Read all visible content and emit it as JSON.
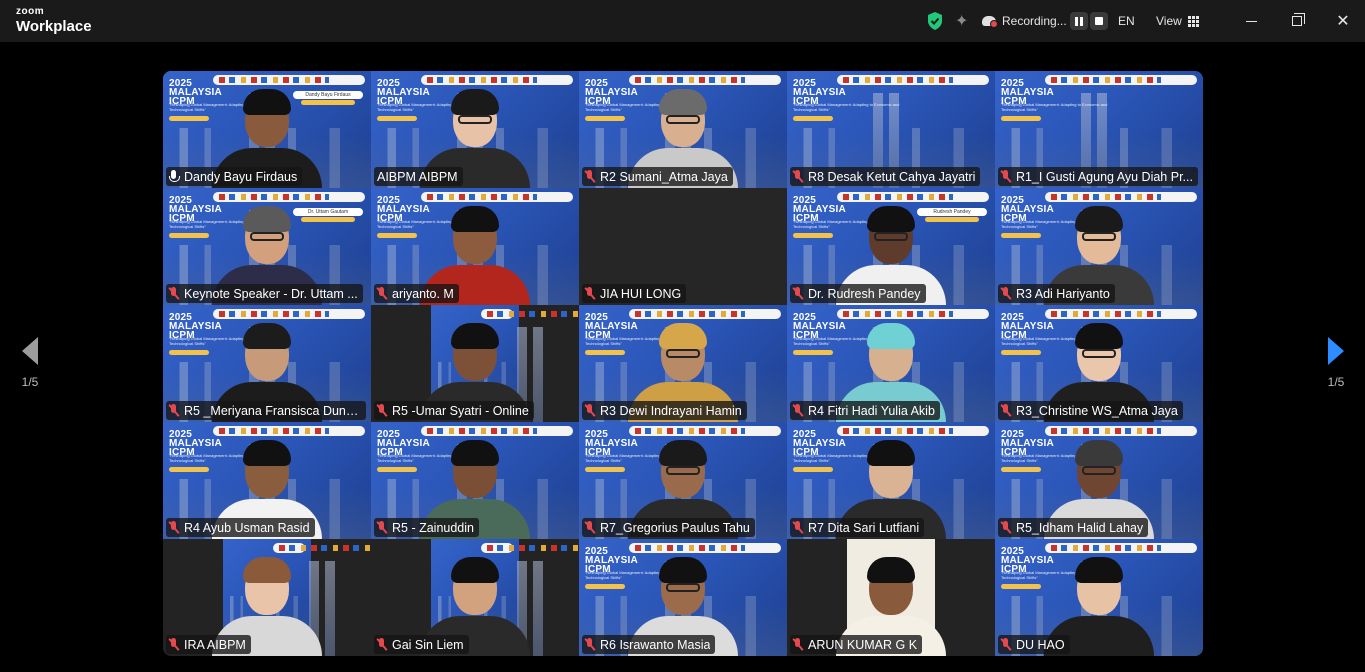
{
  "app": {
    "brand_top": "zoom",
    "brand_bottom": "Workplace"
  },
  "topbar": {
    "recording_label": "Recording...",
    "language": "EN",
    "view_label": "View",
    "close_glyph": "✕",
    "sparkle_glyph": "✦"
  },
  "pager": {
    "left_label": "1/5",
    "right_label": "1/5"
  },
  "colors": {
    "speaking_outline": "#21c87a",
    "muted_icon": "#e5484d",
    "accent": "#2d8cff",
    "slide_blue": "#2b56b8"
  },
  "slide": {
    "title_line1": "2025",
    "title_line2": "MALAYSIA",
    "title_line3": "ICPM",
    "subtitle": "\"Reshaping Global Management: Adapting to Economic and Technological Shifts\""
  },
  "participants": [
    {
      "name": "Dandy Bayu Firdaus",
      "mic": "on",
      "speaking": true,
      "bg": "slide",
      "skin": "#8a5a3c",
      "hair": "#111",
      "shirt": "#1c1c1c",
      "glasses": false,
      "card": "Dandy Bayu Firdaus"
    },
    {
      "name": "AIBPM AIBPM",
      "mic": "none",
      "speaking": false,
      "bg": "slide",
      "skin": "#e8c2a6",
      "hair": "#1a1a1a",
      "shirt": "#2a2a2a",
      "glasses": true,
      "card": ""
    },
    {
      "name": "R2 Sumani_Atma Jaya",
      "mic": "off",
      "speaking": false,
      "bg": "slide",
      "skin": "#d9b08f",
      "hair": "#6b6b6b",
      "shirt": "#c9c9c9",
      "glasses": true,
      "card": ""
    },
    {
      "name": "R8 Desak Ketut Cahya Jayatri",
      "mic": "off",
      "speaking": false,
      "bg": "slide",
      "skin": "",
      "hair": "",
      "shirt": "",
      "glasses": false,
      "card": ""
    },
    {
      "name": "R1_I Gusti Agung Ayu Diah Pr...",
      "mic": "off",
      "speaking": false,
      "bg": "slide",
      "skin": "",
      "hair": "",
      "shirt": "",
      "glasses": false,
      "card": ""
    },
    {
      "name": "Keynote Speaker - Dr. Uttam ...",
      "mic": "off",
      "speaking": false,
      "bg": "slide",
      "skin": "#d2a07c",
      "hair": "#5a5a5a",
      "shirt": "#2d2d4a",
      "glasses": true,
      "card": "Dr. Uttam Gautam"
    },
    {
      "name": "ariyanto. M",
      "mic": "off",
      "speaking": false,
      "bg": "slide",
      "skin": "#8d5b3d",
      "hair": "#111",
      "shirt": "#b3261e",
      "glasses": false,
      "card": ""
    },
    {
      "name": "JIA HUI LONG",
      "mic": "off",
      "speaking": false,
      "bg": "blank",
      "skin": "",
      "hair": "",
      "shirt": "",
      "glasses": false,
      "card": ""
    },
    {
      "name": "Dr. Rudresh Pandey",
      "mic": "off",
      "speaking": false,
      "bg": "slide",
      "skin": "#5e3b2a",
      "hair": "#111",
      "shirt": "#f0f0f0",
      "glasses": true,
      "card": "Rudresh Pandey"
    },
    {
      "name": "R3 Adi Hariyanto",
      "mic": "off",
      "speaking": false,
      "bg": "slide",
      "skin": "#e3bb98",
      "hair": "#1a1a1a",
      "shirt": "#3a3a3a",
      "glasses": true,
      "card": ""
    },
    {
      "name": "R5 _Meriyana Fransisca Dung...",
      "mic": "off",
      "speaking": false,
      "bg": "slide",
      "skin": "#c79a7a",
      "hair": "#1c1c1c",
      "shirt": "#1c1c1c",
      "glasses": false,
      "card": ""
    },
    {
      "name": "R5 -Umar Syatri - Online",
      "mic": "off",
      "speaking": false,
      "bg": "narrow",
      "skin": "#7c5138",
      "hair": "#111",
      "shirt": "#2a2a2a",
      "glasses": false,
      "card": ""
    },
    {
      "name": "R3 Dewi Indrayani Hamin",
      "mic": "off",
      "speaking": false,
      "bg": "slide",
      "skin": "#b98a66",
      "hair": "#d6a64a",
      "shirt": "#cf9f45",
      "glasses": true,
      "card": ""
    },
    {
      "name": "R4 Fitri Hadi Yulia Akib",
      "mic": "off",
      "speaking": false,
      "bg": "slide",
      "skin": "#d7b090",
      "hair": "#6fd1d4",
      "shirt": "#78cbd0",
      "glasses": false,
      "card": ""
    },
    {
      "name": "R3_Christine WS_Atma Jaya",
      "mic": "off",
      "speaking": false,
      "bg": "slide",
      "skin": "#eac7ab",
      "hair": "#111",
      "shirt": "#1f1f1f",
      "glasses": true,
      "card": ""
    },
    {
      "name": "R4 Ayub Usman Rasid",
      "mic": "off",
      "speaking": false,
      "bg": "slide",
      "skin": "#8b5d3f",
      "hair": "#111",
      "shirt": "#f2f2f2",
      "glasses": false,
      "card": ""
    },
    {
      "name": "R5 - Zainuddin",
      "mic": "off",
      "speaking": false,
      "bg": "slide",
      "skin": "#7a4f35",
      "hair": "#111",
      "shirt": "#4a6a5a",
      "glasses": false,
      "card": ""
    },
    {
      "name": "R7_Gregorius Paulus Tahu",
      "mic": "off",
      "speaking": false,
      "bg": "slide",
      "skin": "#9a6a4c",
      "hair": "#1a1a1a",
      "shirt": "#2a2a2a",
      "glasses": true,
      "card": ""
    },
    {
      "name": "R7 Dita Sari Lutfiani",
      "mic": "off",
      "speaking": false,
      "bg": "slide",
      "skin": "#d9b394",
      "hair": "#111",
      "shirt": "#2a2a2a",
      "glasses": false,
      "card": ""
    },
    {
      "name": "R5_Idham Halid Lahay",
      "mic": "off",
      "speaking": false,
      "bg": "slide",
      "skin": "#6e4631",
      "hair": "#3a3a3a",
      "shirt": "#dadada",
      "glasses": true,
      "card": ""
    },
    {
      "name": "IRA AIBPM",
      "mic": "off",
      "speaking": false,
      "bg": "narrow",
      "skin": "#eac4a8",
      "hair": "#8a5a3a",
      "shirt": "#d8d8d8",
      "glasses": false,
      "card": ""
    },
    {
      "name": "Gai Sin Liem",
      "mic": "off",
      "speaking": false,
      "bg": "narrow",
      "skin": "#d2a27f",
      "hair": "#111",
      "shirt": "#2a2a2a",
      "glasses": false,
      "card": ""
    },
    {
      "name": "R6 Israwanto Masia",
      "mic": "off",
      "speaking": false,
      "bg": "slide",
      "skin": "#9b6b4b",
      "hair": "#111",
      "shirt": "#dcdcdc",
      "glasses": true,
      "card": ""
    },
    {
      "name": "ARUN KUMAR G K",
      "mic": "off",
      "speaking": false,
      "bg": "cream",
      "skin": "#8a5a3c",
      "hair": "#111",
      "shirt": "#f5f0e6",
      "glasses": false,
      "card": ""
    },
    {
      "name": "DU HAO",
      "mic": "off",
      "speaking": false,
      "bg": "slide",
      "skin": "#e7c2a4",
      "hair": "#111",
      "shirt": "#1f1f1f",
      "glasses": false,
      "card": ""
    }
  ]
}
